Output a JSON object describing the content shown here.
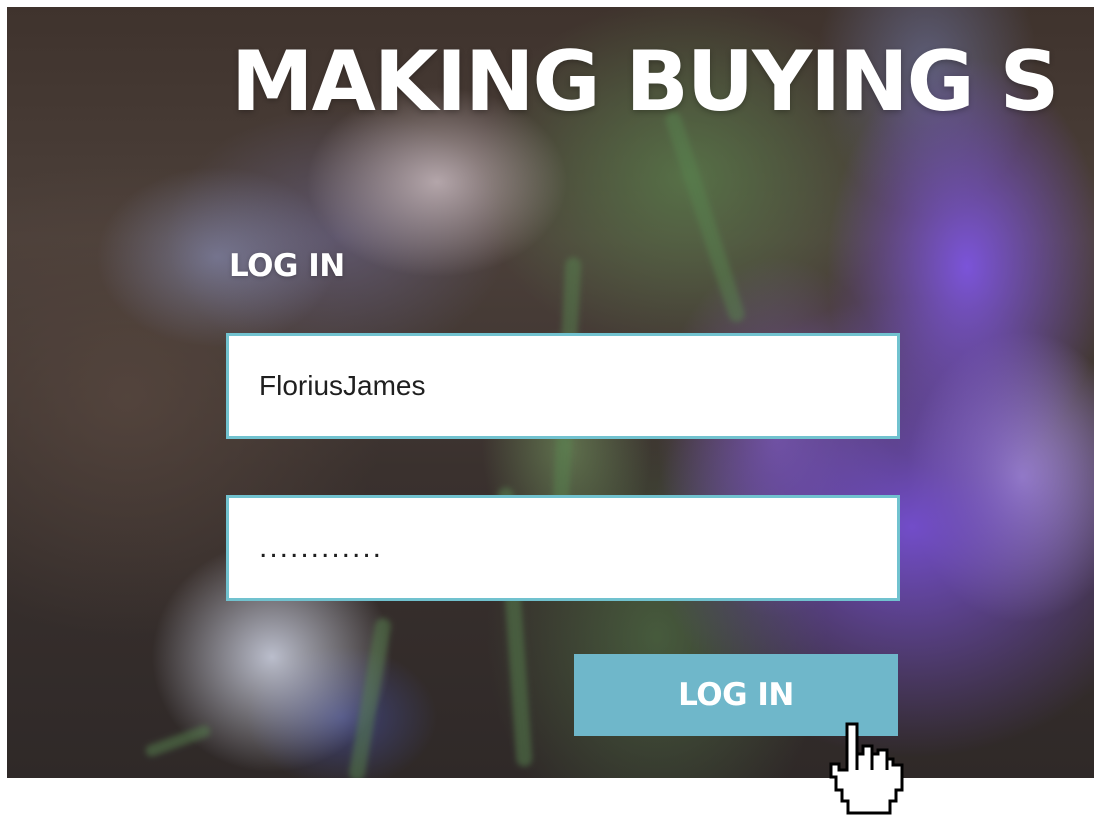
{
  "hero": {
    "headline": "MAKING BUYING S"
  },
  "login": {
    "title": "LOG IN",
    "username_value": "FloriusJames",
    "password_value": "............",
    "button_label": "LOG IN"
  },
  "colors": {
    "accent": "#71c2cf",
    "button": "#6fb7ca",
    "text": "#ffffff"
  },
  "icons": {
    "cursor": "hand-pointer-icon"
  }
}
